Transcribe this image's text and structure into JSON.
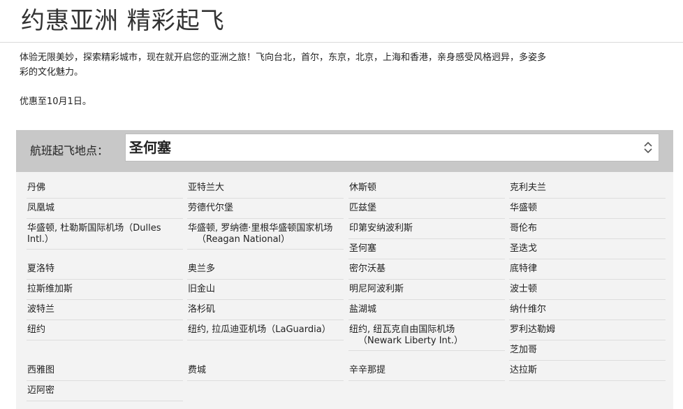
{
  "page": {
    "title": "约惠亚洲 精彩起飞",
    "description": "体验无限美妙，探索精彩城市，现在就开启您的亚洲之旅！飞向台北，首尔，东京，北京，上海和香港，亲身感受风格迥异，多姿多彩的文化魅力。",
    "offer": "优惠至10月1日。"
  },
  "origin": {
    "label": "航班起飞地点：",
    "selected": "圣何塞"
  },
  "cities": {
    "col1": [
      {
        "line1": "丹佛"
      },
      {
        "line1": "凤凰城"
      },
      {
        "line1": "华盛顿, 杜勒斯国际机场（Dulles",
        "line2": "Intl.）"
      },
      {
        "line1": "夏洛特"
      },
      {
        "line1": "拉斯维加斯"
      },
      {
        "line1": "波特兰"
      },
      {
        "line1": "纽约"
      },
      {
        "line1": "西雅图"
      },
      {
        "line1": "迈阿密"
      }
    ],
    "col2": [
      {
        "line1": "亚特兰大"
      },
      {
        "line1": "劳德代尔堡"
      },
      {
        "line1": "华盛顿, 罗纳德·里根华盛顿国家机场",
        "line2": "（Reagan National）"
      },
      {
        "line1": "奥兰多"
      },
      {
        "line1": "旧金山"
      },
      {
        "line1": "洛杉矶"
      },
      {
        "line1": "纽约, 拉瓜迪亚机场（LaGuardia）"
      },
      {
        "line1": "费城"
      }
    ],
    "col3": [
      {
        "line1": "休斯顿"
      },
      {
        "line1": "匹兹堡"
      },
      {
        "line1": "印第安纳波利斯"
      },
      {
        "line1": "圣何塞"
      },
      {
        "line1": "密尔沃基"
      },
      {
        "line1": "明尼阿波利斯"
      },
      {
        "line1": "盐湖城"
      },
      {
        "line1": "纽约, 纽瓦克自由国际机场",
        "line2": "（Newark Liberty Int.）"
      },
      {
        "line1": "辛辛那提"
      }
    ],
    "col4": [
      {
        "line1": "克利夫兰"
      },
      {
        "line1": "华盛顿"
      },
      {
        "line1": "哥伦布"
      },
      {
        "line1": "圣迭戈"
      },
      {
        "line1": "底特律"
      },
      {
        "line1": "波士顿"
      },
      {
        "line1": "纳什维尔"
      },
      {
        "line1": "罗利达勒姆"
      },
      {
        "line1": "芝加哥"
      },
      {
        "line1": "达拉斯"
      }
    ]
  }
}
